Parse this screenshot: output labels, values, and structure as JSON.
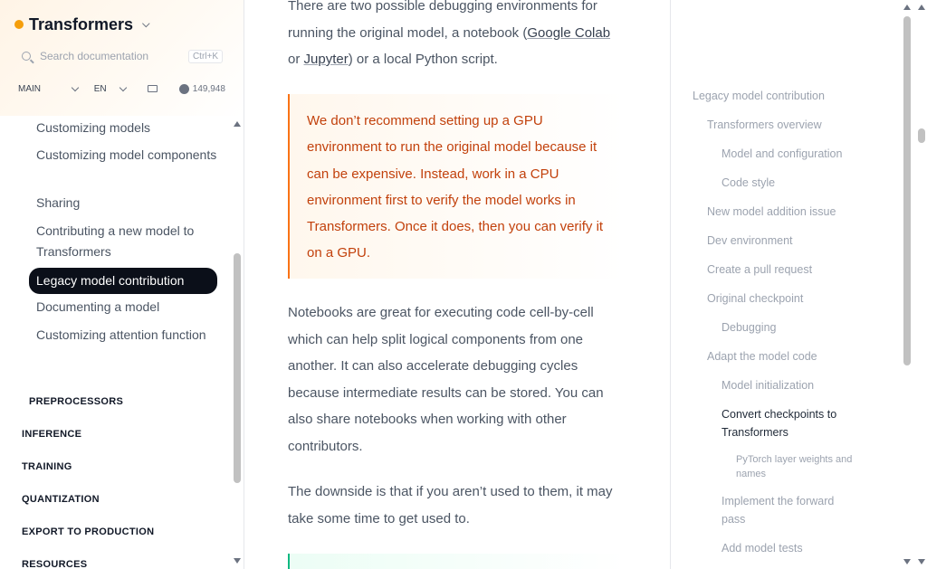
{
  "sidebar": {
    "brand": "Transformers",
    "search_placeholder": "Search documentation",
    "search_shortcut": "Ctrl+K",
    "version": "MAIN",
    "language": "EN",
    "github_stars": "149,948",
    "items": [
      "Customizing models",
      "Customizing model components",
      "Sharing",
      "Contributing a new model to Transformers",
      "Legacy model contribution",
      "Documenting a model",
      "Customizing attention function"
    ],
    "active_item": "Legacy model contribution",
    "sections": [
      "PREPROCESSORS",
      "INFERENCE",
      "TRAINING",
      "QUANTIZATION",
      "EXPORT TO PRODUCTION",
      "RESOURCES"
    ]
  },
  "main": {
    "intro_before": "There are two possible debugging environments for running the original model, a notebook (",
    "link_google_colab": "Google Colab",
    "intro_or": " or ",
    "link_jupyter": "Jupyter",
    "intro_after": ") or a local Python script.",
    "warning": "We don’t recommend setting up a GPU environment to run the original model because it can be expensive. Instead, work in a CPU environment first to verify the model works in Transformers. Once it does, then you can verify it on a GPU.",
    "para_notebooks": "Notebooks are great for executing code cell-by-cell which can help split logical components from one another. It can also accelerate debugging cycles because intermediate results can be stored. You can also share notebooks when working with other contributors.",
    "para_downside": "The downside is that if you aren’t used to them, it may take some time to get used to."
  },
  "toc": {
    "items": [
      "Legacy model contribution",
      "Transformers overview",
      "Model and configuration",
      "Code style",
      "New model addition issue",
      "Dev environment",
      "Create a pull request",
      "Original checkpoint",
      "Debugging",
      "Adapt the model code",
      "Model initialization",
      "Convert checkpoints to Transformers",
      "PyTorch layer weights and names",
      "Implement the forward pass",
      "Add model tests"
    ],
    "current": "Convert checkpoints to Transformers"
  },
  "colors": {
    "accent": "#f97316",
    "warning_text": "#c2410c",
    "active_bg": "#0b0f19",
    "tip_border": "#10b981"
  }
}
